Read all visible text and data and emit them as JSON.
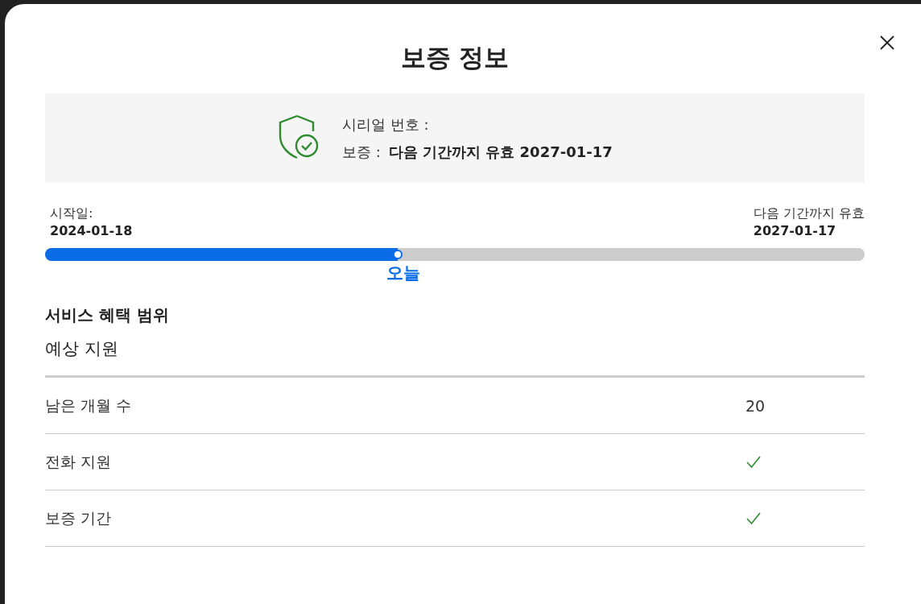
{
  "dialog": {
    "title": "보증 정보"
  },
  "summary": {
    "serial_label": "시리얼 번호 :",
    "warranty_label": "보증 :",
    "warranty_value": "다음 기간까지 유효 2027-01-17"
  },
  "timeline": {
    "start_label": "시작일:",
    "start_date": "2024-01-18",
    "end_label": "다음 기간까지 유효",
    "end_date": "2027-01-17",
    "level": 0.43,
    "marker_label": "오늘"
  },
  "coverage": {
    "heading": "서비스 혜택 범위",
    "subheading": "예상 지원",
    "rows": [
      {
        "label": "남은 개월 수",
        "kind": "text",
        "value": "20"
      },
      {
        "label": "전화 지원",
        "kind": "check",
        "checked": true
      },
      {
        "label": "보증 기간",
        "kind": "check",
        "checked": true
      }
    ]
  }
}
